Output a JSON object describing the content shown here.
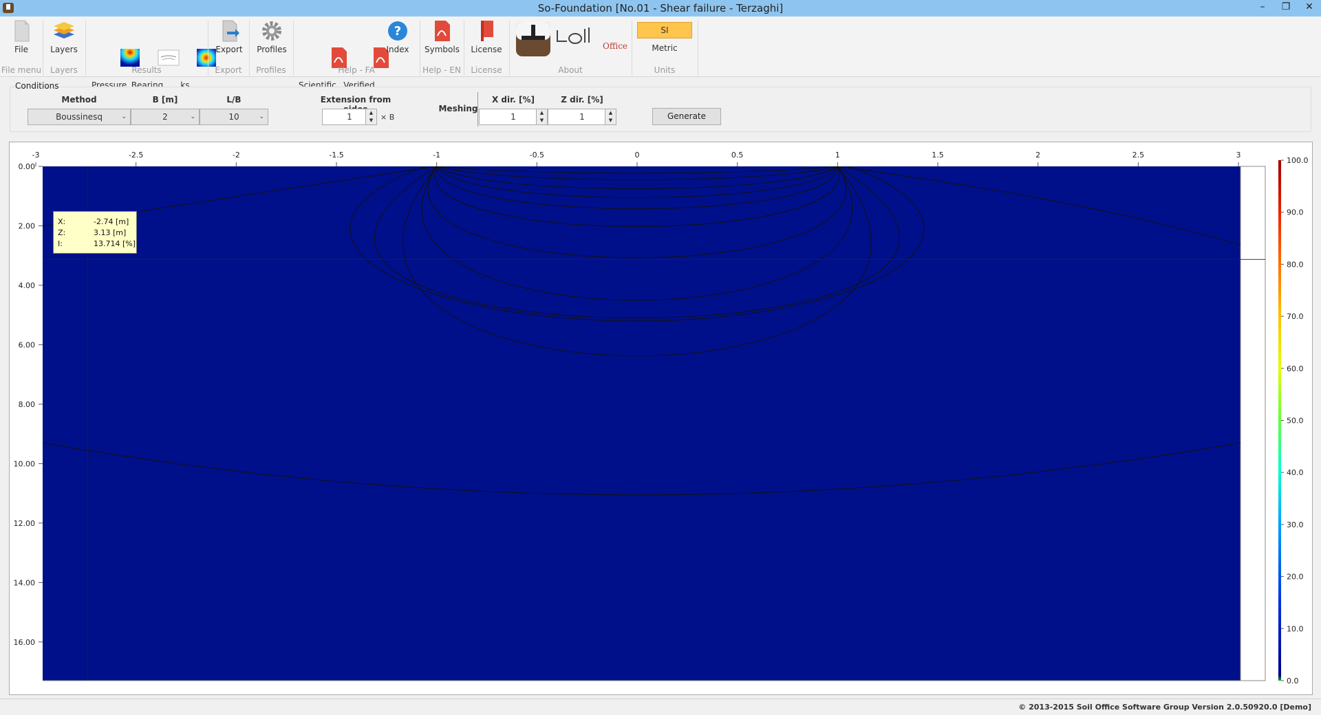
{
  "window": {
    "title": "So-Foundation [No.01 - Shear failure - Terzaghi]"
  },
  "ribbon": {
    "buttons": [
      {
        "id": "file",
        "label": "File"
      },
      {
        "id": "layers",
        "label": "Layers"
      },
      {
        "id": "pressure",
        "label": "Pressure\nisobars"
      },
      {
        "id": "bearing",
        "label": "Bearing\ncapacity"
      },
      {
        "id": "ks",
        "label": "ks\ncontour"
      },
      {
        "id": "export",
        "label": "Export"
      },
      {
        "id": "profiles",
        "label": "Profiles"
      },
      {
        "id": "scientific",
        "label": "Scientific\nmanual"
      },
      {
        "id": "verified",
        "label": "Verified\nexamples"
      },
      {
        "id": "index",
        "label": "Index"
      },
      {
        "id": "symbols",
        "label": "Symbols"
      },
      {
        "id": "license",
        "label": "License"
      },
      {
        "id": "metric",
        "label": "Metric"
      }
    ],
    "groups": [
      "File menu",
      "Layers",
      "Results",
      "Export",
      "Profiles",
      "Help - FA",
      "Help - EN",
      "License",
      "About",
      "Units"
    ],
    "units_toggle": "SI",
    "logo_text": "Office"
  },
  "conditions": {
    "title": "Conditions",
    "method_label": "Method",
    "method_value": "Boussinesq",
    "b_label": "B [m]",
    "b_value": "2",
    "lb_label": "L/B",
    "lb_value": "10",
    "extension_label": "Extension from sides",
    "extension_value": "1",
    "extension_unit": "× B",
    "meshing_label": "Meshing",
    "xdir_label": "X dir. [%]",
    "xdir_value": "1",
    "zdir_label": "Z dir. [%]",
    "zdir_value": "1",
    "generate_label": "Generate"
  },
  "tooltip": {
    "x_key": "X:",
    "x_val": "-2.74 [m]",
    "z_key": "Z:",
    "z_val": "3.13 [m]",
    "i_key": "I:",
    "i_val": "13.714 [%]"
  },
  "chart_data": {
    "type": "heatmap",
    "x_ticks": [
      "-3",
      "-2.5",
      "-2",
      "-1.5",
      "-1",
      "-0.5",
      "0",
      "0.5",
      "1",
      "1.5",
      "2",
      "2.5",
      "3"
    ],
    "y_ticks": [
      "0.00",
      "2.00",
      "4.00",
      "6.00",
      "8.00",
      "10.00",
      "12.00",
      "14.00",
      "16.00"
    ],
    "xlim": [
      -3,
      3
    ],
    "ylim": [
      0,
      17.3
    ],
    "colorbar_ticks": [
      "100.0",
      "90.0",
      "80.0",
      "70.0",
      "60.0",
      "50.0",
      "40.0",
      "30.0",
      "20.0",
      "10.0",
      "0.0"
    ],
    "colorbar_range": [
      0,
      100
    ],
    "colors": [
      "#00008a",
      "#0020d0",
      "#0070ff",
      "#00d8ff",
      "#30ff80",
      "#c8ff00",
      "#ffd000",
      "#ff7000",
      "#e01000",
      "#800000"
    ],
    "crosshair": {
      "x": -2.74,
      "z": 3.13
    },
    "footing": {
      "x": [
        -1,
        1
      ],
      "z": 0
    }
  },
  "status": {
    "copyright": "© 2013-2015 Soil Office Software Group   Version 2.0.50920.0 [Demo]"
  }
}
